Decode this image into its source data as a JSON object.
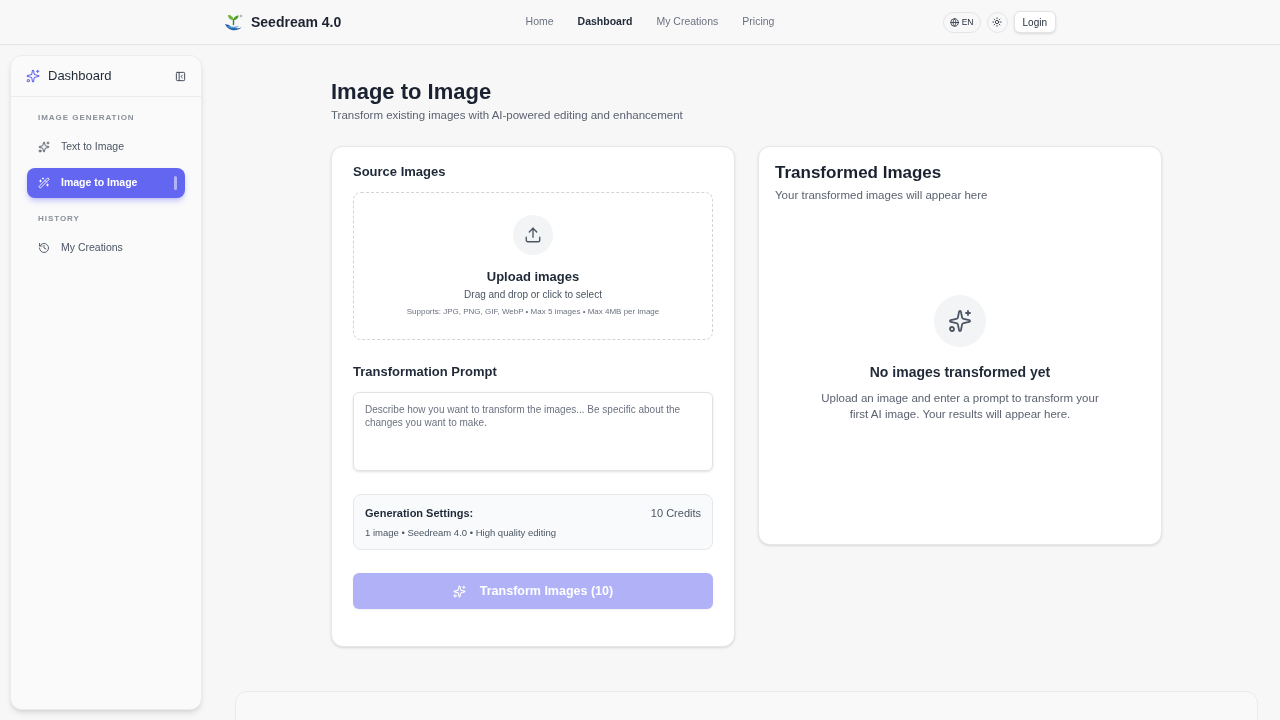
{
  "header": {
    "brand": "Seedream 4.0",
    "nav": [
      {
        "label": "Home",
        "selected": false
      },
      {
        "label": "Dashboard",
        "selected": true
      },
      {
        "label": "My Creations",
        "selected": false
      },
      {
        "label": "Pricing",
        "selected": false
      }
    ],
    "language": "EN",
    "login": "Login"
  },
  "sidebar": {
    "title": "Dashboard",
    "sections": [
      {
        "heading": "IMAGE GENERATION",
        "items": [
          {
            "label": "Text to Image",
            "selected": false
          },
          {
            "label": "Image to Image",
            "selected": true
          }
        ]
      },
      {
        "heading": "HISTORY",
        "items": [
          {
            "label": "My Creations",
            "selected": false
          }
        ]
      }
    ]
  },
  "page": {
    "title": "Image to Image",
    "subtitle": "Transform existing images with AI-powered editing and enhancement"
  },
  "source_panel": {
    "title": "Source Images",
    "upload": {
      "title": "Upload images",
      "hint": "Drag and drop or click to select",
      "formats": "Supports: JPG, PNG, GIF, WebP • Max 5 images • Max 4MB per image"
    },
    "prompt": {
      "label": "Transformation Prompt",
      "placeholder": "Describe how you want to transform the images... Be specific about the changes you want to make."
    },
    "settings": {
      "title": "Generation Settings:",
      "credits": "10 Credits",
      "details": "1 image • Seedream 4.0 • High quality editing"
    },
    "submit": {
      "label": "Transform Images (10)",
      "disabled": true
    }
  },
  "result_panel": {
    "title": "Transformed Images",
    "subtitle": "Your transformed images will appear here",
    "empty": {
      "title": "No images transformed yet",
      "message": "Upload an image and enter a prompt to transform your first AI image. Your results will appear here."
    }
  }
}
